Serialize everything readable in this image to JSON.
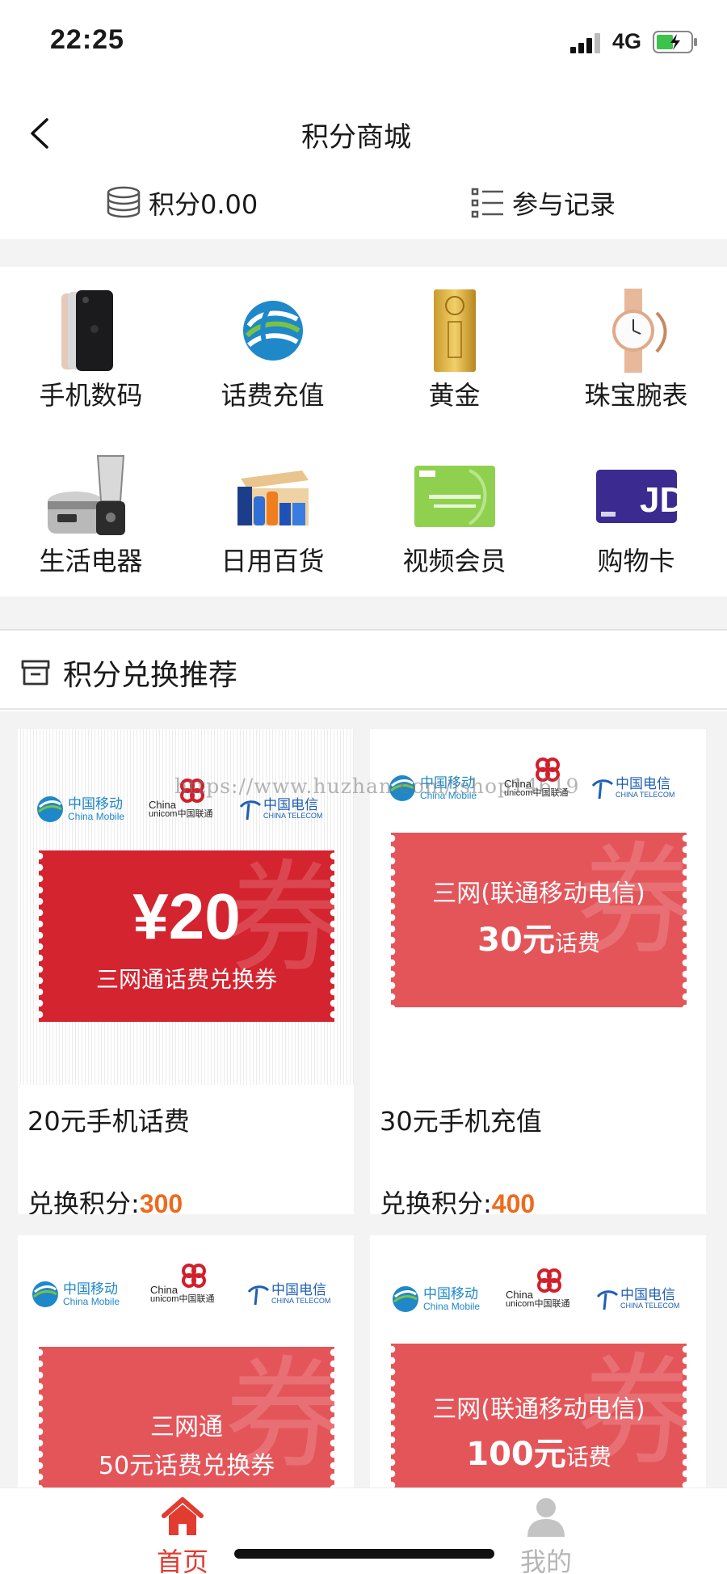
{
  "status": {
    "time": "22:25",
    "network": "4G"
  },
  "nav": {
    "title": "积分商城"
  },
  "points": {
    "balance_label": "积分0.00",
    "records_label": "参与记录"
  },
  "categories": [
    {
      "label": "手机数码",
      "icon": "phone-icon"
    },
    {
      "label": "话费充值",
      "icon": "china-mobile-icon"
    },
    {
      "label": "黄金",
      "icon": "gold-bar-icon"
    },
    {
      "label": "珠宝腕表",
      "icon": "watch-icon"
    },
    {
      "label": "生活电器",
      "icon": "appliance-icon"
    },
    {
      "label": "日用百货",
      "icon": "groceries-icon"
    },
    {
      "label": "视频会员",
      "icon": "video-card-icon"
    },
    {
      "label": "购物卡",
      "icon": "jd-card-icon"
    }
  ],
  "section": {
    "title": "积分兑换推荐"
  },
  "watermark": "https://www.huzhan.com/ishop14619",
  "logos": {
    "mobile_cn": "中国移动",
    "mobile_en": "China Mobile",
    "unicom_en1": "China",
    "unicom_en2": "unicom中国联通",
    "telecom_cn": "中国电信",
    "telecom_en": "CHINA TELECOM"
  },
  "coupon_watermark": "券",
  "products": [
    {
      "name": "20元手机话费",
      "price_label": "兑换积分:",
      "price": "300",
      "coupon_amount": "¥20",
      "coupon_text": "三网通话费兑换券"
    },
    {
      "name": "30元手机充值",
      "price_label": "兑换积分:",
      "price": "400",
      "coupon_line1": "三网(联通移动电信)",
      "coupon_line2_amount": "30元",
      "coupon_line2_suffix": "话费"
    },
    {
      "coupon_line1": "三网通",
      "coupon_line2": "50元话费兑换券"
    },
    {
      "coupon_line1": "三网(联通移动电信)",
      "coupon_line2_amount": "100元",
      "coupon_line2_suffix": "话费"
    }
  ],
  "tabs": [
    {
      "label": "首页",
      "icon": "home-icon",
      "active": true
    },
    {
      "label": "我的",
      "icon": "user-icon",
      "active": false
    }
  ],
  "colors": {
    "accent": "#e23b30",
    "price": "#ee6a1c",
    "coupon": "#e4555a",
    "coupon_dark": "#d4242f",
    "inactive_tab": "#c4c4c4"
  }
}
